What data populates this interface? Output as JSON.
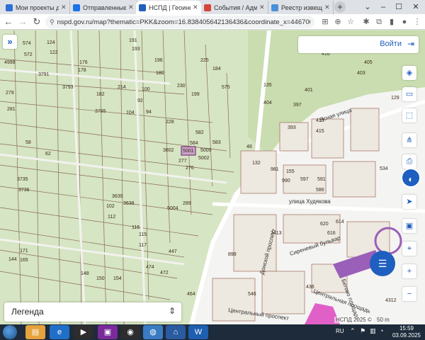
{
  "browser": {
    "tabs": [
      {
        "title": "Мои проекты до",
        "favicon_color": "#2f6fd6"
      },
      {
        "title": "Отправленные",
        "favicon_color": "#1a73e8"
      },
      {
        "title": "НСПД | Геоинфо",
        "favicon_color": "#1f5fbf"
      },
      {
        "title": "События / Адми",
        "favicon_color": "#d44638"
      },
      {
        "title": "Реестр извещен",
        "favicon_color": "#4a90d9"
      }
    ],
    "url": "nspd.gov.ru/map?thematic=PKK&zoom=16.838405642136436&coordinate_x=4467007.3793167...",
    "new_tab_symbol": "+"
  },
  "map": {
    "login_label": "Войти",
    "legend_label": "Легенда",
    "attribution": "НСПД 2025 ©",
    "scale_label": "50 m",
    "streets": [
      "Ясная улица",
      "улица Худякова",
      "Сиреневый бульвар",
      "Центральный проспект",
      "Донской проспект",
      "Центральная площадь",
      "Бегово площади"
    ],
    "parcel_labels": [
      {
        "t": "574",
        "c": 0
      },
      {
        "t": "572",
        "c": 0
      },
      {
        "t": "124",
        "c": 0
      },
      {
        "t": "122",
        "c": 0
      },
      {
        "t": "191",
        "c": 0
      },
      {
        "t": "193",
        "c": 0
      },
      {
        "t": "196",
        "c": 0
      },
      {
        "t": "176",
        "c": 0
      },
      {
        "t": "178",
        "c": 0
      },
      {
        "t": "180",
        "c": 0
      },
      {
        "t": "225",
        "c": 0
      },
      {
        "t": "184",
        "c": 0
      },
      {
        "t": "3791",
        "c": 0
      },
      {
        "t": "4998",
        "c": 0
      },
      {
        "t": "279",
        "c": 0
      },
      {
        "t": "281",
        "c": 0
      },
      {
        "t": "3793",
        "c": 0
      },
      {
        "t": "182",
        "c": 0
      },
      {
        "t": "214",
        "c": 0
      },
      {
        "t": "100",
        "c": 0
      },
      {
        "t": "92",
        "c": 0
      },
      {
        "t": "230",
        "c": 0
      },
      {
        "t": "199",
        "c": 0
      },
      {
        "t": "575",
        "c": 0
      },
      {
        "t": "3785",
        "c": 0
      },
      {
        "t": "104",
        "c": 0
      },
      {
        "t": "94",
        "c": 0
      },
      {
        "t": "228",
        "c": 0
      },
      {
        "t": "584",
        "c": 0
      },
      {
        "t": "582",
        "c": 0
      },
      {
        "t": "583",
        "c": 0
      },
      {
        "t": "3802",
        "c": 0
      },
      {
        "t": "5001",
        "c": 1
      },
      {
        "t": "5000",
        "c": 0
      },
      {
        "t": "5002",
        "c": 0
      },
      {
        "t": "277",
        "c": 0
      },
      {
        "t": "276",
        "c": 0
      },
      {
        "t": "3639",
        "c": 0
      },
      {
        "t": "3638",
        "c": 0
      },
      {
        "t": "5004",
        "c": 0
      },
      {
        "t": "289",
        "c": 0
      },
      {
        "t": "102",
        "c": 0
      },
      {
        "t": "112",
        "c": 0
      },
      {
        "t": "116",
        "c": 0
      },
      {
        "t": "115",
        "c": 0
      },
      {
        "t": "117",
        "c": 0
      },
      {
        "t": "447",
        "c": 0
      },
      {
        "t": "474",
        "c": 0
      },
      {
        "t": "472",
        "c": 0
      },
      {
        "t": "171",
        "c": 0
      },
      {
        "t": "165",
        "c": 0
      },
      {
        "t": "144",
        "c": 0
      },
      {
        "t": "148",
        "c": 0
      },
      {
        "t": "150",
        "c": 0
      },
      {
        "t": "154",
        "c": 0
      },
      {
        "t": "3736",
        "c": 0
      },
      {
        "t": "3735",
        "c": 0
      },
      {
        "t": "416",
        "c": 0
      },
      {
        "t": "403",
        "c": 0
      },
      {
        "t": "405",
        "c": 0
      },
      {
        "t": "135",
        "c": 0
      },
      {
        "t": "404",
        "c": 0
      },
      {
        "t": "401",
        "c": 0
      },
      {
        "t": "397",
        "c": 0
      },
      {
        "t": "393",
        "c": 0
      },
      {
        "t": "413",
        "c": 0
      },
      {
        "t": "415",
        "c": 0
      },
      {
        "t": "534",
        "c": 0
      },
      {
        "t": "132",
        "c": 0
      },
      {
        "t": "155",
        "c": 0
      },
      {
        "t": "981",
        "c": 0
      },
      {
        "t": "990",
        "c": 0
      },
      {
        "t": "597",
        "c": 0
      },
      {
        "t": "591",
        "c": 0
      },
      {
        "t": "586",
        "c": 0
      },
      {
        "t": "620",
        "c": 0
      },
      {
        "t": "614",
        "c": 0
      },
      {
        "t": "616",
        "c": 0
      },
      {
        "t": "899",
        "c": 0
      },
      {
        "t": "2413",
        "c": 0
      },
      {
        "t": "4312",
        "c": 0
      },
      {
        "t": "436",
        "c": 0
      },
      {
        "t": "464",
        "c": 0
      },
      {
        "t": "546",
        "c": 0
      },
      {
        "t": "129",
        "c": 0
      },
      {
        "t": "48",
        "c": 0
      },
      {
        "t": "58",
        "c": 0
      },
      {
        "t": "62",
        "c": 0
      }
    ]
  },
  "taskbar": {
    "lang": "RU",
    "time": "15:59",
    "date": "03.09.2025"
  }
}
